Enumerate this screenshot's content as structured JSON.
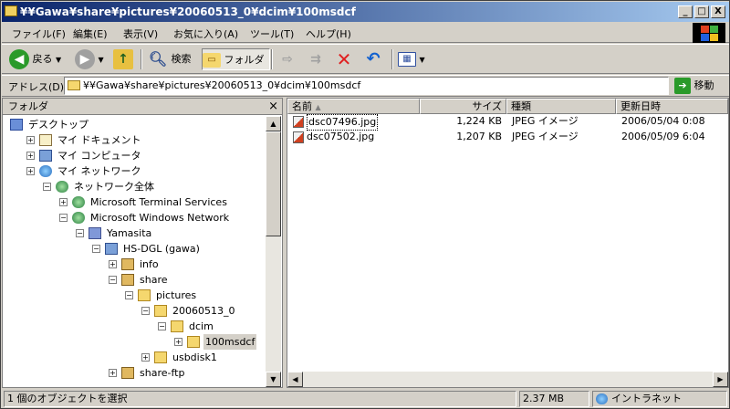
{
  "window": {
    "title": "¥¥Gawa¥share¥pictures¥20060513_0¥dcim¥100msdcf",
    "min": "_",
    "max": "□",
    "close": "X"
  },
  "menu": [
    "ファイル(F)",
    "編集(E)",
    "表示(V)",
    "お気に入り(A)",
    "ツール(T)",
    "ヘルプ(H)"
  ],
  "toolbar": {
    "back": "戻る",
    "search": "検索",
    "folders": "フォルダ"
  },
  "address": {
    "label": "アドレス(D)",
    "value": "¥¥Gawa¥share¥pictures¥20060513_0¥dcim¥100msdcf",
    "go": "移動"
  },
  "folder_pane": {
    "title": "フォルダ",
    "close": "×"
  },
  "tree": [
    {
      "label": "デスクトップ",
      "level": 0,
      "exp": "",
      "icon": "idesk"
    },
    {
      "label": "マイ ドキュメント",
      "level": 1,
      "exp": "+",
      "icon": "idoc"
    },
    {
      "label": "マイ コンピュータ",
      "level": 1,
      "exp": "+",
      "icon": "icomp"
    },
    {
      "label": "マイ ネットワーク",
      "level": 1,
      "exp": "+",
      "icon": "inet"
    },
    {
      "label": "ネットワーク全体",
      "level": 2,
      "exp": "−",
      "icon": "iglobe"
    },
    {
      "label": "Microsoft Terminal Services",
      "level": 3,
      "exp": "+",
      "icon": "iglobe"
    },
    {
      "label": "Microsoft Windows Network",
      "level": 3,
      "exp": "−",
      "icon": "iglobe"
    },
    {
      "label": "Yamasita",
      "level": 4,
      "exp": "−",
      "icon": "ldomain"
    },
    {
      "label": "HS-DGL (gawa)",
      "level": 5,
      "exp": "−",
      "icon": "icomp"
    },
    {
      "label": "info",
      "level": 6,
      "exp": "+",
      "icon": "ishare"
    },
    {
      "label": "share",
      "level": 6,
      "exp": "−",
      "icon": "ishare"
    },
    {
      "label": "pictures",
      "level": 7,
      "exp": "−",
      "icon": "ifolder"
    },
    {
      "label": "20060513_0",
      "level": 8,
      "exp": "−",
      "icon": "ifolder"
    },
    {
      "label": "dcim",
      "level": 9,
      "exp": "−",
      "icon": "ifolder"
    },
    {
      "label": "100msdcf",
      "level": 10,
      "exp": "+",
      "icon": "ifolder",
      "selected": true
    },
    {
      "label": "usbdisk1",
      "level": 8,
      "exp": "+",
      "icon": "ifolder"
    },
    {
      "label": "share-ftp",
      "level": 6,
      "exp": "+",
      "icon": "ishare"
    }
  ],
  "columns": [
    "名前",
    "サイズ",
    "種類",
    "更新日時"
  ],
  "files": [
    {
      "name": "dsc07496.jpg",
      "size": "1,224 KB",
      "type": "JPEG イメージ",
      "modified": "2006/05/04 0:08"
    },
    {
      "name": "dsc07502.jpg",
      "size": "1,207 KB",
      "type": "JPEG イメージ",
      "modified": "2006/05/09 6:04"
    }
  ],
  "status": {
    "objects": "1 個のオブジェクトを選択",
    "size": "2.37 MB",
    "zone": "イントラネット"
  }
}
